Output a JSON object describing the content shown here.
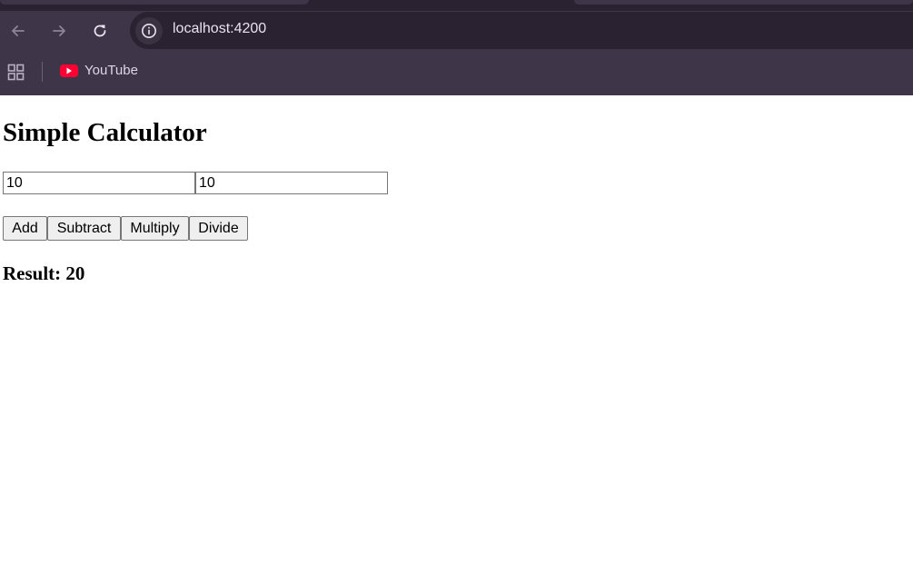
{
  "browser": {
    "url": "localhost:4200",
    "bookmarks": [
      {
        "label": "YouTube",
        "icon": "youtube-icon"
      }
    ],
    "colors": {
      "chrome": "#3f3549",
      "omnibox": "#2a2230",
      "youtube": "#ff0033"
    }
  },
  "page": {
    "title": "Simple Calculator",
    "inputs": {
      "first_value": "10",
      "second_value": "10"
    },
    "buttons": {
      "add": "Add",
      "subtract": "Subtract",
      "multiply": "Multiply",
      "divide": "Divide"
    },
    "result_label": "Result:",
    "result_value": "20"
  }
}
